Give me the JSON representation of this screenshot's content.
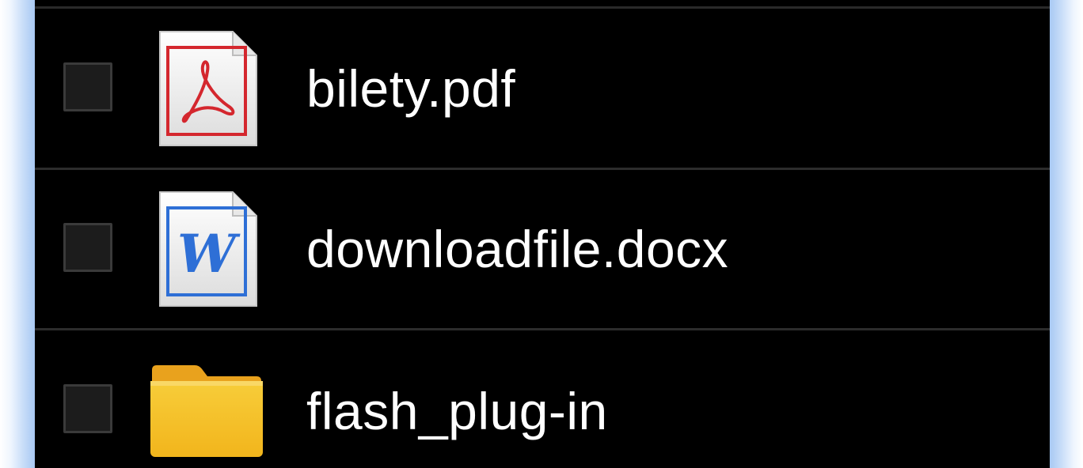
{
  "file_list": {
    "items": [
      {
        "name": "bilety.pdf",
        "icon": "pdf-file-icon",
        "checked": false
      },
      {
        "name": "downloadfile.docx",
        "icon": "word-document-icon",
        "checked": false
      },
      {
        "name": "flash_plug-in",
        "icon": "folder-icon",
        "checked": false
      }
    ]
  },
  "colors": {
    "background": "#000000",
    "text": "#ffffff",
    "divider": "#2c2c2c",
    "pdf_red": "#d4272e",
    "word_blue": "#2e6fd6",
    "folder_yellow": "#f5c52a",
    "frame_blue": "#a9c9f3"
  }
}
